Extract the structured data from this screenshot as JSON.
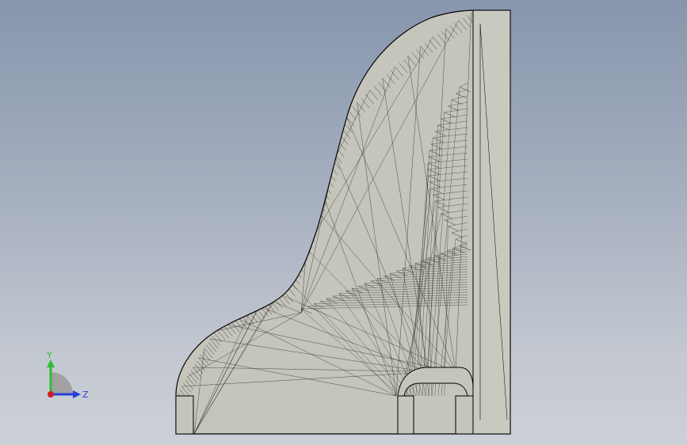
{
  "viewport": {
    "background_top": "#8796ad",
    "background_bottom": "#ccd0d7"
  },
  "model": {
    "face_color": "#c5c5bc",
    "mesh_color": "#1a1a1a",
    "outline_color": "#000000"
  },
  "triad": {
    "y_label": "Y",
    "z_label": "Z",
    "y_color": "#2fbf2f",
    "z_color": "#2a3fd6",
    "x_color": "#d02020"
  }
}
